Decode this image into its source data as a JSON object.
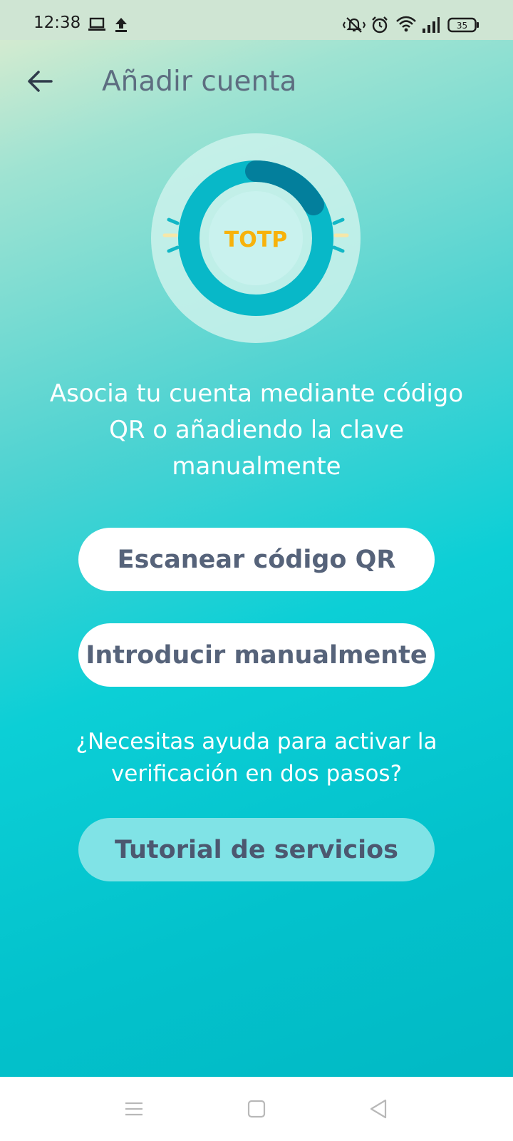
{
  "status_bar": {
    "time": "12:38",
    "battery": "35",
    "icons": [
      "laptop-icon",
      "upload-icon",
      "vibrate-icon",
      "alarm-icon",
      "wifi-icon",
      "signal-icon",
      "battery-icon"
    ]
  },
  "header": {
    "back_icon": "arrow-left-icon",
    "title": "Añadir cuenta"
  },
  "illustration": {
    "label": "TOTP",
    "colors": {
      "outer_circle": "#cdf2ec",
      "ring": "#08b8c8",
      "ring_dark": "#037f9c",
      "inner": "#c9f2ee",
      "label": "#f7b20b"
    }
  },
  "main": {
    "description": "Asocia tu cuenta mediante código QR o añadiendo la clave manualmente",
    "scan_button": "Escanear código QR",
    "manual_button": "Introducir manualmente",
    "help_text": "¿Necesitas ayuda para activar la verificación en dos pasos?",
    "tutorial_button": "Tutorial de servicios"
  },
  "nav_bar": {
    "icons": [
      "menu-icon",
      "home-square-icon",
      "back-triangle-icon"
    ]
  },
  "colors": {
    "title": "#5d6d80",
    "button_text": "#56637a",
    "button_bg": "#ffffff",
    "tutorial_bg": "#80e3e6"
  }
}
